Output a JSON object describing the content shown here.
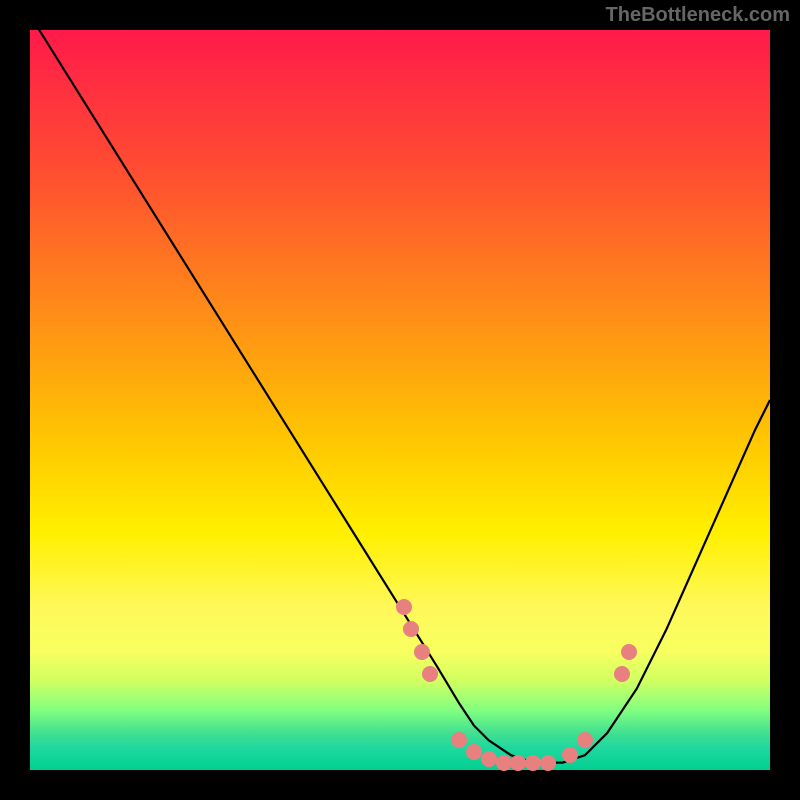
{
  "watermark": "TheBottleneck.com",
  "chart_data": {
    "type": "line",
    "title": "",
    "xlabel": "",
    "ylabel": "",
    "xlim": [
      0,
      100
    ],
    "ylim": [
      0,
      100
    ],
    "series": [
      {
        "name": "curve",
        "x": [
          0,
          5,
          10,
          15,
          20,
          25,
          30,
          35,
          40,
          45,
          50,
          55,
          58,
          60,
          62,
          65,
          68,
          70,
          72,
          75,
          78,
          82,
          86,
          90,
          94,
          98,
          100
        ],
        "y": [
          102,
          94,
          86,
          78,
          70,
          62,
          54,
          46,
          38,
          30,
          22,
          14,
          9,
          6,
          4,
          2,
          1,
          1,
          1,
          2,
          5,
          11,
          19,
          28,
          37,
          46,
          50
        ]
      }
    ],
    "scatter_points": [
      {
        "x": 50.5,
        "y": 22
      },
      {
        "x": 51.5,
        "y": 19
      },
      {
        "x": 53,
        "y": 16
      },
      {
        "x": 54,
        "y": 13
      },
      {
        "x": 58,
        "y": 4
      },
      {
        "x": 60,
        "y": 2.5
      },
      {
        "x": 62,
        "y": 1.5
      },
      {
        "x": 64,
        "y": 1
      },
      {
        "x": 66,
        "y": 1
      },
      {
        "x": 68,
        "y": 1
      },
      {
        "x": 70,
        "y": 1
      },
      {
        "x": 73,
        "y": 2
      },
      {
        "x": 75,
        "y": 4
      },
      {
        "x": 80,
        "y": 13
      },
      {
        "x": 81,
        "y": 16
      }
    ],
    "colors": {
      "curve": "#000000",
      "dots": "#e88080",
      "gradient_top": "#ff1a4a",
      "gradient_mid": "#fff000",
      "gradient_bottom": "#00d090"
    }
  }
}
